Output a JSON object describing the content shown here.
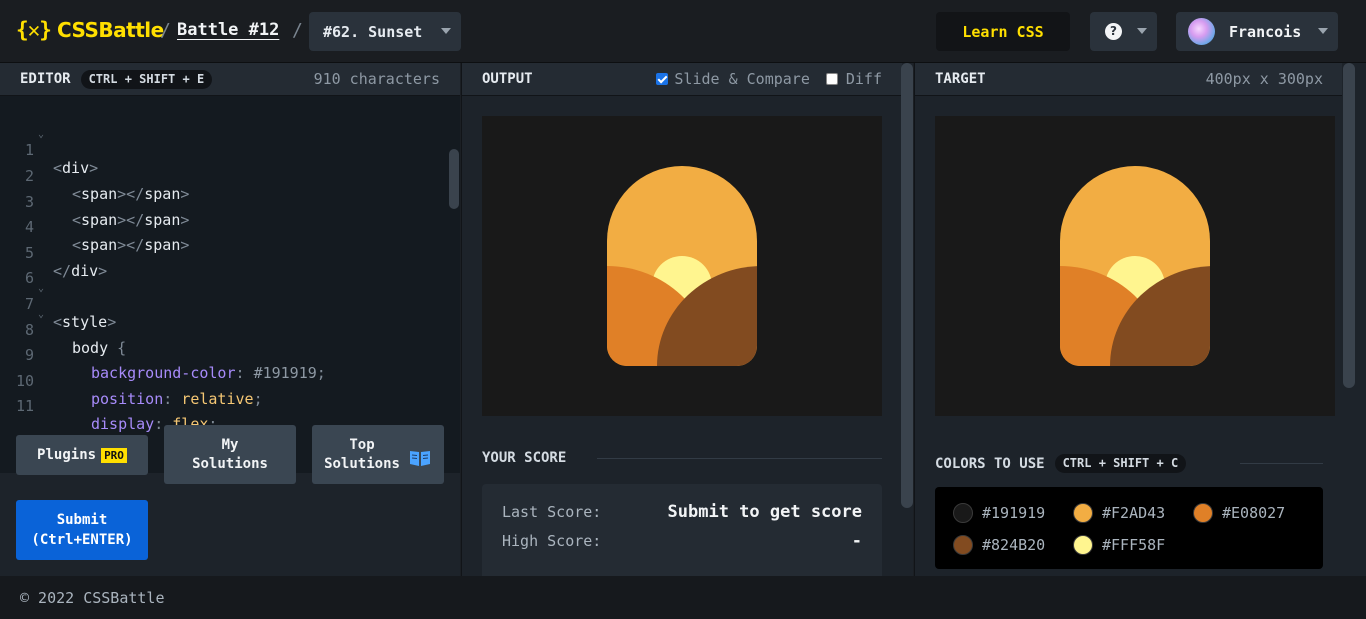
{
  "header": {
    "logo_mark": "{✕}",
    "logo_text": "CSSBattle",
    "sep": "/",
    "battle": "Battle #12",
    "target": "#62. Sunset",
    "learn": "Learn CSS",
    "help": "?",
    "user": "Francois"
  },
  "editor": {
    "title": "EDITOR",
    "shortcut": "CTRL + SHIFT + E",
    "chars": "910 characters",
    "lines": [
      {
        "n": "1",
        "fold": true
      },
      {
        "n": "2",
        "fold": false
      },
      {
        "n": "3",
        "fold": false
      },
      {
        "n": "4",
        "fold": false
      },
      {
        "n": "5",
        "fold": false
      },
      {
        "n": "6",
        "fold": false
      },
      {
        "n": "7",
        "fold": true
      },
      {
        "n": "8",
        "fold": true
      },
      {
        "n": "9",
        "fold": false
      },
      {
        "n": "10",
        "fold": false
      },
      {
        "n": "11",
        "fold": false
      }
    ],
    "code": {
      "div": "div",
      "span": "span",
      "style": "style",
      "body_sel": "body",
      "bg_prop": "background-color",
      "bg_val": "#191919",
      "pos_prop": "position",
      "pos_val": "relative",
      "disp_prop": "display",
      "disp_val": "flex"
    },
    "plugins": "Plugins",
    "pro": "PRO",
    "my_solutions_1": "My",
    "my_solutions_2": "Solutions",
    "top_solutions_1": "Top",
    "top_solutions_2": "Solutions",
    "submit_1": "Submit",
    "submit_2": "(Ctrl+ENTER)"
  },
  "output": {
    "title": "OUTPUT",
    "slide_compare": "Slide & Compare",
    "slide_checked": true,
    "diff": "Diff",
    "diff_checked": false,
    "score_title": "YOUR SCORE",
    "last_score_label": "Last Score:",
    "last_score_value": "Submit to get score",
    "high_score_label": "High Score:",
    "high_score_value": "-"
  },
  "target": {
    "title": "TARGET",
    "size": "400px x 300px",
    "colors_title": "COLORS TO USE",
    "colors_shortcut": "CTRL + SHIFT + C",
    "colors": [
      "#191919",
      "#F2AD43",
      "#E08027",
      "#824B20",
      "#FFF58F"
    ]
  },
  "footer": {
    "copyright": "© 2022 CSSBattle"
  },
  "theme": {
    "accent": "#ffdf00",
    "submit": "#0a63d8"
  }
}
